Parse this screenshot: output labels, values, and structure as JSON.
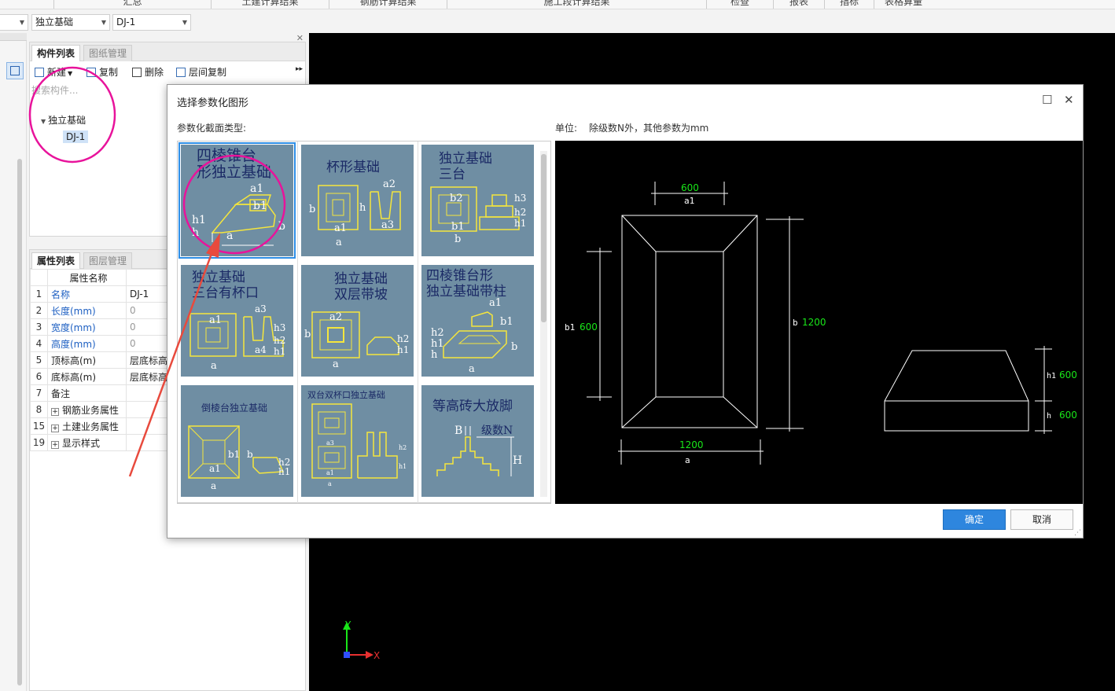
{
  "top_menu": [
    "汇总",
    "土建计算结果",
    "钢筋计算结果",
    "施工段计算结果",
    "检查",
    "报表",
    "指标",
    "表格算量"
  ],
  "selectors": {
    "category": "独立基础",
    "component": "DJ-1"
  },
  "component_panel": {
    "tabs": [
      "构件列表",
      "图纸管理"
    ],
    "toolbar": [
      "新建",
      "复制",
      "删除",
      "层间复制"
    ],
    "search_placeholder": "搜索构件...",
    "tree_parent": "独立基础",
    "tree_child": "DJ-1"
  },
  "property_panel": {
    "tabs": [
      "属性列表",
      "图层管理"
    ],
    "header": "属性名称",
    "rows": [
      {
        "num": "1",
        "name": "名称",
        "value": "DJ-1"
      },
      {
        "num": "2",
        "name": "长度(mm)",
        "value": "0"
      },
      {
        "num": "3",
        "name": "宽度(mm)",
        "value": "0"
      },
      {
        "num": "4",
        "name": "高度(mm)",
        "value": "0"
      },
      {
        "num": "5",
        "name": "顶标高(m)",
        "value": "层底标高"
      },
      {
        "num": "6",
        "name": "底标高(m)",
        "value": "层底标高"
      },
      {
        "num": "7",
        "name": "备注",
        "value": ""
      },
      {
        "num": "8",
        "name": "钢筋业务属性",
        "value": ""
      },
      {
        "num": "15",
        "name": "土建业务属性",
        "value": ""
      },
      {
        "num": "19",
        "name": "显示样式",
        "value": ""
      }
    ]
  },
  "dialog": {
    "title": "选择参数化图形",
    "section_label": "参数化截面类型:",
    "unit_label": "单位:",
    "unit_text": "除级数N外，其他参数为mm",
    "shapes": [
      "四棱锥台形独立基础",
      "杯形基础",
      "独立基础三台",
      "独立基础三台有杯口",
      "独立基础双层带坡",
      "四棱锥台形独立基础带柱",
      "倒棱台独立基础",
      "双台双杯口独立基础",
      "等高砖大放脚"
    ],
    "shape_title_lines": [
      [
        "四棱锥台",
        "形独立基础"
      ],
      [
        "杯形基础"
      ],
      [
        "独立基础",
        "三台"
      ],
      [
        "独立基础",
        "三台有杯口"
      ],
      [
        "独立基础",
        "双层带坡"
      ],
      [
        "四棱锥台形",
        "独立基础带柱"
      ],
      [
        "倒棱台独立基础"
      ],
      [
        "双台双杯口独立基础"
      ],
      [
        "等高砖大放脚"
      ]
    ],
    "selected_index": 0,
    "ok": "确定",
    "cancel": "取消",
    "preview": {
      "a1_value": "600",
      "a1_label": "a1",
      "b1_label": "b1",
      "b1_value": "600",
      "b_label": "b",
      "b_value": "1200",
      "a_value": "1200",
      "a_label": "a",
      "h1_label": "h1",
      "h1_value": "600",
      "h_label": "h",
      "h_value": "600"
    }
  },
  "axis": {
    "x": "X",
    "y": "Y"
  },
  "colors": {
    "accent": "#2e86de",
    "annotation": "#e8139b",
    "arrow": "#e84a3d",
    "dim_value": "#19e619"
  }
}
